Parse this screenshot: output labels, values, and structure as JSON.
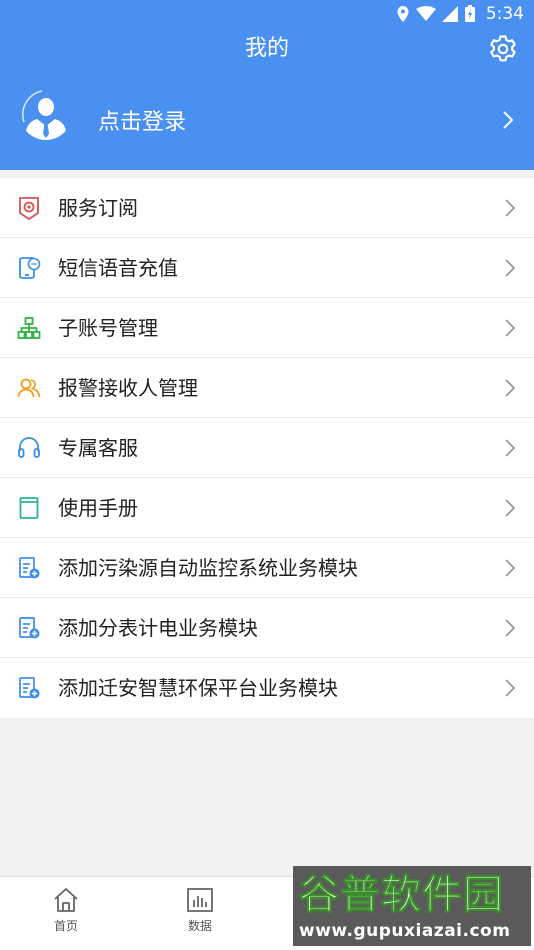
{
  "status_bar": {
    "time": "5:34"
  },
  "header": {
    "title": "我的"
  },
  "login": {
    "label": "点击登录"
  },
  "menu": {
    "items": [
      {
        "label": "服务订阅",
        "icon": "subscription-badge-icon",
        "color": "#d9534f"
      },
      {
        "label": "短信语音充值",
        "icon": "sms-phone-icon",
        "color": "#3a8ee6"
      },
      {
        "label": "子账号管理",
        "icon": "org-tree-icon",
        "color": "#2fb344"
      },
      {
        "label": "报警接收人管理",
        "icon": "people-icon",
        "color": "#f0a020"
      },
      {
        "label": "专属客服",
        "icon": "headset-icon",
        "color": "#3a8ee6"
      },
      {
        "label": "使用手册",
        "icon": "book-icon",
        "color": "#2ab39a"
      },
      {
        "label": "添加污染源自动监控系统业务模块",
        "icon": "doc-add-icon",
        "color": "#3a8ee6"
      },
      {
        "label": "添加分表计电业务模块",
        "icon": "doc-add-icon",
        "color": "#3a8ee6"
      },
      {
        "label": "添加迁安智慧环保平台业务模块",
        "icon": "doc-add-icon",
        "color": "#3a8ee6"
      }
    ]
  },
  "bottom_nav": {
    "home_label": "首页",
    "data_label": "数据"
  },
  "watermark": {
    "main": "谷普软件园",
    "url": "www.gupuxiazai.com"
  },
  "colors": {
    "primary": "#4a90f0",
    "background": "#f2f2f2"
  }
}
